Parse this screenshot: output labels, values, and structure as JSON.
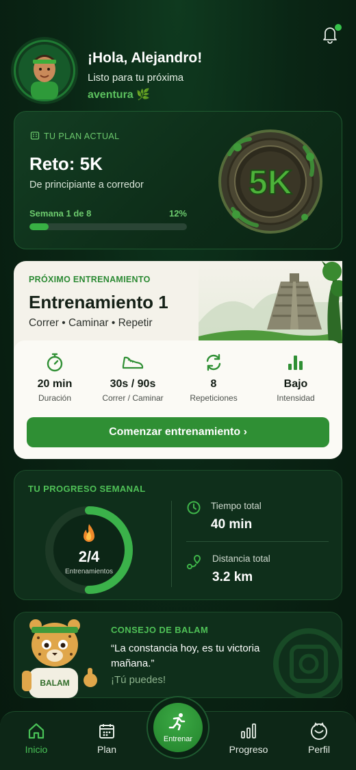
{
  "header": {
    "greeting": "¡Hola, Alejandro!",
    "subtitle_line1": "Listo para tu próxima",
    "subtitle_line2": "aventura 🌿",
    "notification_dot": true
  },
  "plan": {
    "tag": "TU PLAN ACTUAL",
    "title": "Reto: 5K",
    "description": "De principiante a corredor",
    "week_label": "Semana 1 de 8",
    "percent_label": "12%",
    "progress": 0.12,
    "medal_text": "5K"
  },
  "next_workout": {
    "tag": "PRÓXIMO ENTRENAMIENTO",
    "title": "Entrenamiento 1",
    "subtitle": "Correr • Caminar • Repetir",
    "stats": [
      {
        "icon": "stopwatch-icon",
        "value": "20 min",
        "label": "Duración"
      },
      {
        "icon": "shoe-icon",
        "value": "30s / 90s",
        "label": "Correr / Caminar"
      },
      {
        "icon": "repeat-icon",
        "value": "8",
        "label": "Repeticiones"
      },
      {
        "icon": "bars-icon",
        "value": "Bajo",
        "label": "Intensidad"
      }
    ],
    "start_label": "Comenzar entrenamiento  ›"
  },
  "weekly": {
    "tag": "TU PROGRESO SEMANAL",
    "count": "2/4",
    "count_label": "Entrenamientos",
    "ring_fraction": 0.5,
    "time_label": "Tiempo total",
    "time_value": "40 min",
    "distance_label": "Distancia total",
    "distance_value": "3.2 km"
  },
  "tip": {
    "tag": "CONSEJO DE BALAM",
    "quote": "“La constancia hoy, es tu victoria mañana.”",
    "cheer": "¡Tú puedes!",
    "mascot_text": "BALAM"
  },
  "nav": {
    "items": [
      {
        "label": "Inicio",
        "icon": "home-icon",
        "active": true
      },
      {
        "label": "Plan",
        "icon": "calendar-icon",
        "active": false
      },
      {
        "label": "Entrenar",
        "icon": "runner-icon",
        "active": false
      },
      {
        "label": "Progreso",
        "icon": "chart-icon",
        "active": false
      },
      {
        "label": "Perfil",
        "icon": "profile-icon",
        "active": false
      }
    ]
  },
  "colors": {
    "background": "#0a2615",
    "accent": "#38b044",
    "accent_text": "#4fc157",
    "card_light": "#f4f2ea"
  }
}
